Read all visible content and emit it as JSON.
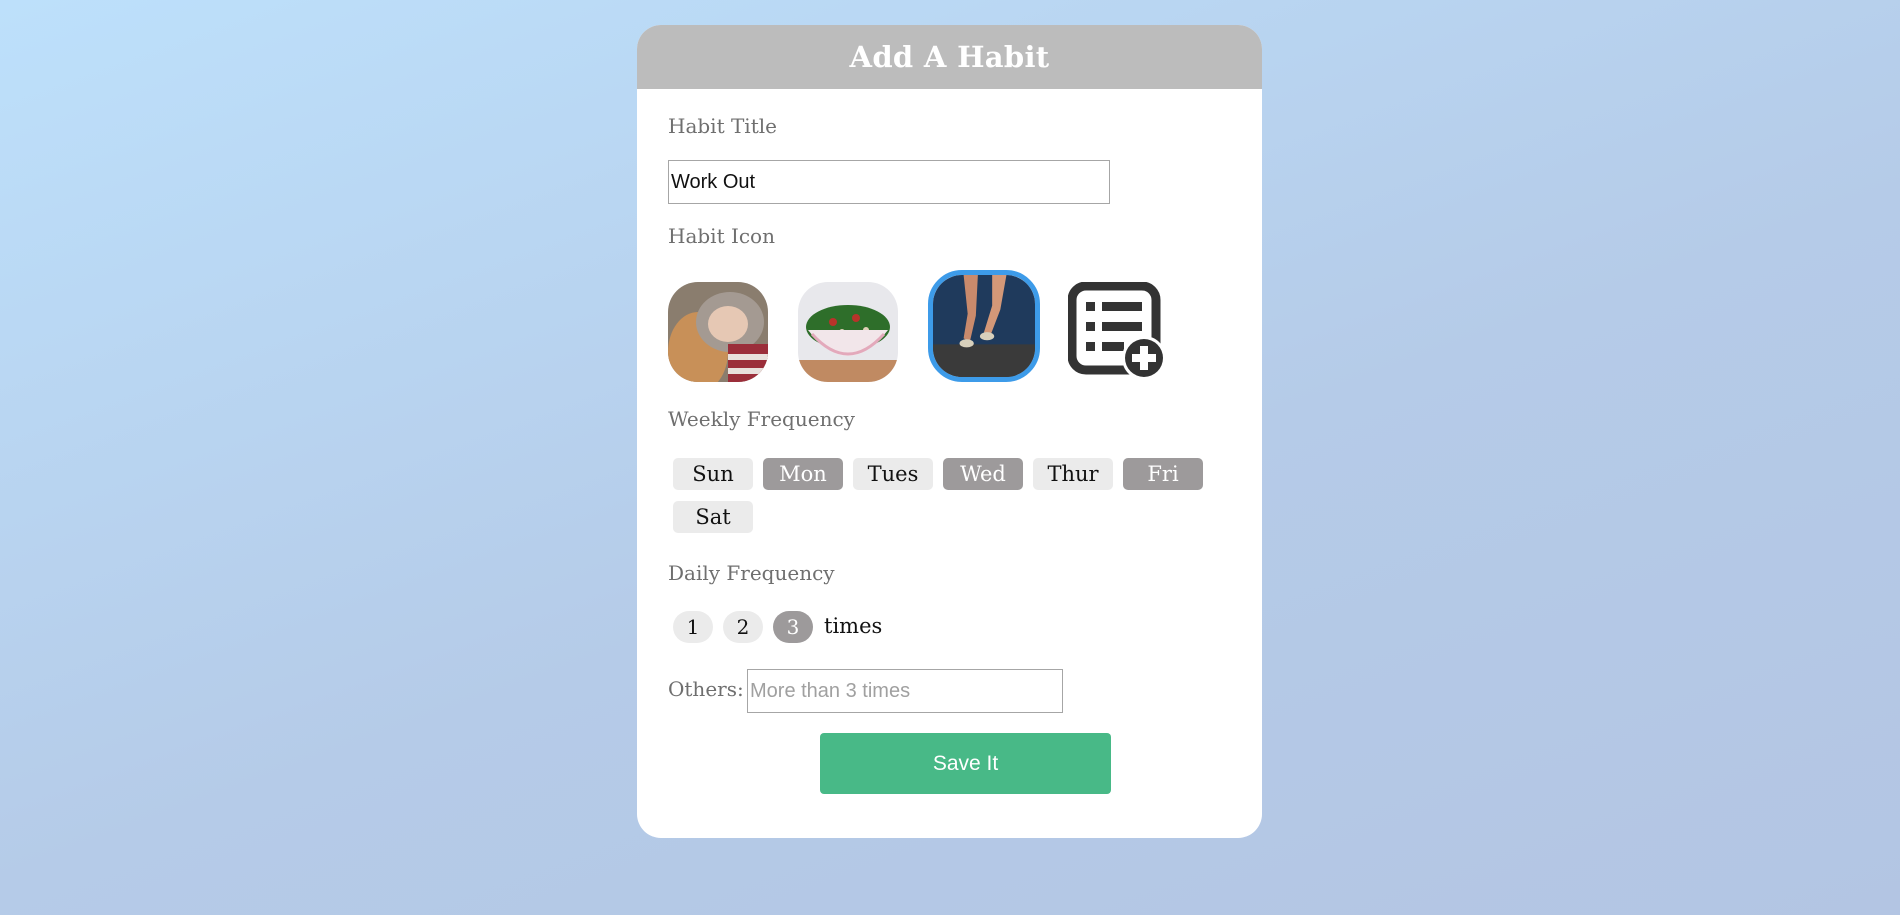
{
  "header": {
    "title": "Add A Habit"
  },
  "habit_title": {
    "label": "Habit Title",
    "value": "Work Out"
  },
  "habit_icon": {
    "label": "Habit Icon",
    "options": [
      {
        "name": "sleep-icon",
        "selected": false
      },
      {
        "name": "salad-icon",
        "selected": false
      },
      {
        "name": "running-icon",
        "selected": true
      },
      {
        "name": "add-custom-icon",
        "selected": false
      }
    ]
  },
  "weekly_frequency": {
    "label": "Weekly Frequency",
    "days": [
      {
        "label": "Sun",
        "selected": false
      },
      {
        "label": "Mon",
        "selected": true
      },
      {
        "label": "Tues",
        "selected": false
      },
      {
        "label": "Wed",
        "selected": true
      },
      {
        "label": "Thur",
        "selected": false
      },
      {
        "label": "Fri",
        "selected": true
      },
      {
        "label": "Sat",
        "selected": false
      }
    ]
  },
  "daily_frequency": {
    "label": "Daily Frequency",
    "options": [
      {
        "label": "1",
        "selected": false
      },
      {
        "label": "2",
        "selected": false
      },
      {
        "label": "3",
        "selected": true
      }
    ],
    "suffix": "times"
  },
  "others": {
    "label": "Others:",
    "placeholder": "More than 3 times",
    "value": ""
  },
  "save_button": {
    "label": "Save It"
  },
  "colors": {
    "header_bg": "#bcbcbc",
    "selected_pill": "#9d9a9b",
    "unselected_pill": "#ebebeb",
    "selected_icon_border": "#3d9be9",
    "save_button": "#48b987"
  }
}
